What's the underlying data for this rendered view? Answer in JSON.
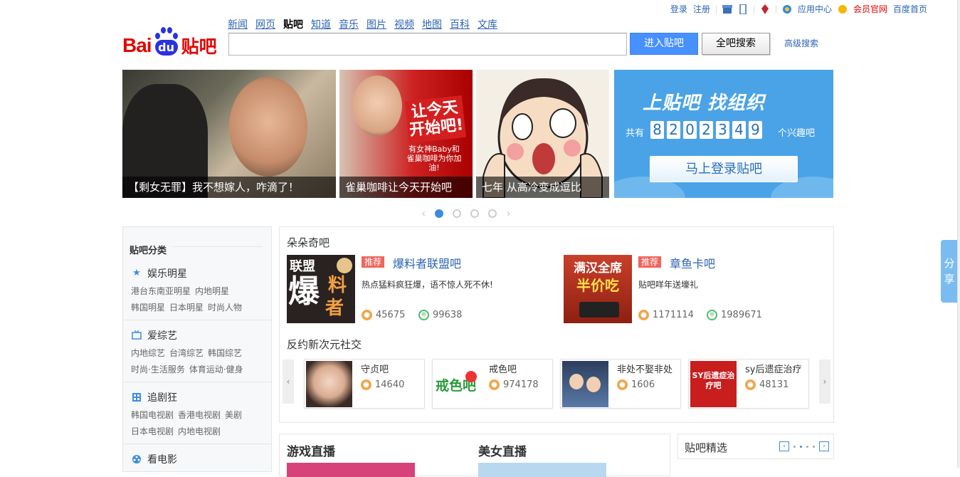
{
  "userbar": {
    "login": "登录",
    "register": "注册",
    "app_center": "应用中心",
    "vip": "会员官网",
    "baidu_home": "百度首页"
  },
  "logo": {
    "bai": "Bai",
    "du": "du",
    "tieba": "贴吧"
  },
  "nav": {
    "links": [
      "新闻",
      "网页",
      "贴吧",
      "知道",
      "音乐",
      "图片",
      "视频",
      "地图",
      "百科",
      "文库"
    ],
    "active": "贴吧"
  },
  "search": {
    "value": "",
    "enter_button": "进入贴吧",
    "all_button": "全吧搜索",
    "advanced": "高级搜索"
  },
  "banners": [
    {
      "caption": "【剩女无罪】我不想嫁人，咋滴了！"
    },
    {
      "caption": "雀巢咖啡让今天开始吧",
      "art_text": "让今天开始吧!",
      "art_sub": "有女神Baby和雀巢咖啡为你加油!"
    },
    {
      "caption": "七年 从高冷变成逗比"
    },
    {
      "title": "上贴吧 找组织",
      "count_prefix": "共有",
      "digits": [
        "8",
        "2",
        "0",
        "2",
        "3",
        "4",
        "9"
      ],
      "count_suffix": "个兴趣吧",
      "login_button": "马上登录贴吧"
    }
  ],
  "sidebar": {
    "title": "贴吧分类",
    "categories": [
      {
        "name": "娱乐明星",
        "icon": "star-icon",
        "rows": [
          [
            "港台东南亚明星",
            "内地明星"
          ],
          [
            "韩国明星",
            "日本明星",
            "时尚人物"
          ]
        ]
      },
      {
        "name": "爱综艺",
        "icon": "tv-icon",
        "rows": [
          [
            "内地综艺",
            "台湾综艺",
            "韩国综艺"
          ],
          [
            "时尚·生活服务",
            "体育运动·健身"
          ]
        ]
      },
      {
        "name": "追剧狂",
        "icon": "film-icon",
        "rows": [
          [
            "韩国电视剧",
            "香港电视剧",
            "美剧"
          ],
          [
            "日本电视剧",
            "内地电视剧"
          ]
        ]
      },
      {
        "name": "看电影",
        "icon": "film-reel-icon",
        "rows": []
      }
    ]
  },
  "duoduoqi": {
    "title": "朵朵奇吧",
    "featured": [
      {
        "tag": "推荐",
        "name": "爆料者联盟吧",
        "desc": "热点猛料疯狂爆，语不惊人死不休!",
        "members": "45675",
        "posts": "99638",
        "img_text": "联盟爆料者"
      },
      {
        "tag": "推荐",
        "name": "章鱼卡吧",
        "desc": "贴吧咩年送壕礼",
        "members": "1171114",
        "posts": "1989671",
        "img_text": "满汉全席半价吃"
      }
    ]
  },
  "social": {
    "title": "反约新次元社交",
    "cards": [
      {
        "name": "守贞吧",
        "count": "14640"
      },
      {
        "name": "戒色吧",
        "count": "974178",
        "img_text": "戒色吧"
      },
      {
        "name": "非处不娶非处",
        "count": "1606"
      },
      {
        "name": "sy后遗症治疗",
        "count": "48131",
        "img_text": "SY后遗症治疗吧"
      }
    ]
  },
  "live": {
    "game": "游戏直播",
    "beauty": "美女直播"
  },
  "jingxuan": {
    "title": "贴吧精选"
  },
  "share": {
    "label_top": "分",
    "label_bottom": "享"
  },
  "colors": {
    "accent": "#2d64b3",
    "brand_red": "#e10602",
    "brand_blue": "#2932e1",
    "button_blue": "#4791ff",
    "tag_red": "#f0655d"
  }
}
